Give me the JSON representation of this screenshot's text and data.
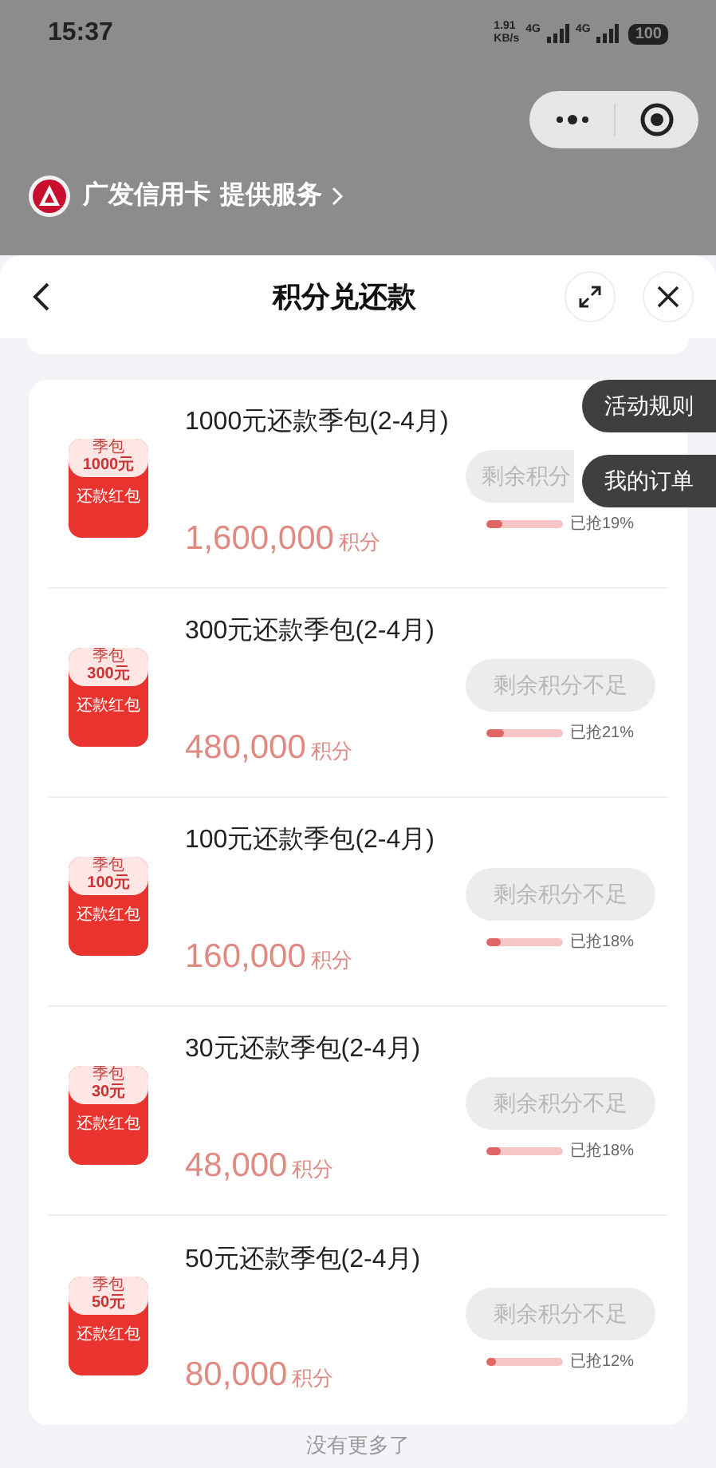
{
  "status_bar": {
    "time": "15:37",
    "net_speed": "1.91\nKB/s",
    "sim1": "4G",
    "sim2": "4G",
    "battery": "100"
  },
  "provider": {
    "name": "广发信用卡",
    "action": "提供服务"
  },
  "sheet": {
    "title": "积分兑还款"
  },
  "side_buttons": [
    "活动规则",
    "我的订单"
  ],
  "items": [
    {
      "badge_top": "季包",
      "badge_amount": "1000元",
      "badge_label": "还款红包",
      "title": "1000元还款季包(2-4月)",
      "points": "1,600,000",
      "unit": "积分",
      "button": "剩余积分",
      "covered": true,
      "disabled": true,
      "level": 0.19,
      "sold": "已抢19%"
    },
    {
      "badge_top": "季包",
      "badge_amount": "300元",
      "badge_label": "还款红包",
      "title": "300元还款季包(2-4月)",
      "points": "480,000",
      "unit": "积分",
      "button": "剩余积分不足",
      "disabled": true,
      "level": 0.21,
      "sold": "已抢21%"
    },
    {
      "badge_top": "季包",
      "badge_amount": "100元",
      "badge_label": "还款红包",
      "title": "100元还款季包(2-4月)",
      "points": "160,000",
      "unit": "积分",
      "button": "剩余积分不足",
      "disabled": true,
      "level": 0.18,
      "sold": "已抢18%"
    },
    {
      "badge_top": "季包",
      "badge_amount": "30元",
      "badge_label": "还款红包",
      "title": "30元还款季包(2-4月)",
      "points": "48,000",
      "unit": "积分",
      "button": "剩余积分不足",
      "disabled": true,
      "level": 0.18,
      "sold": "已抢18%"
    },
    {
      "badge_top": "季包",
      "badge_amount": "50元",
      "badge_label": "还款红包",
      "title": "50元还款季包(2-4月)",
      "points": "80,000",
      "unit": "积分",
      "button": "剩余积分不足",
      "disabled": true,
      "level": 0.12,
      "sold": "已抢12%"
    }
  ],
  "footer": "没有更多了"
}
